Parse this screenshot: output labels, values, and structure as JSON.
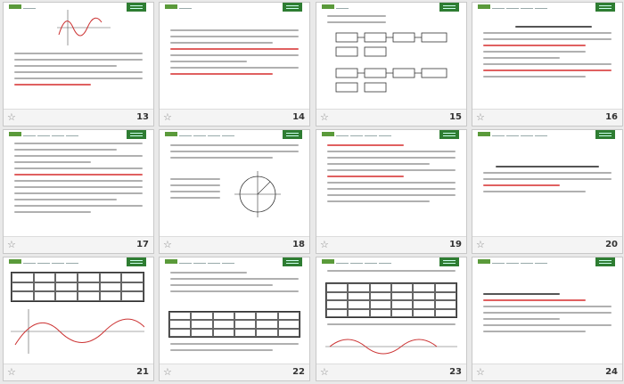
{
  "slides": [
    {
      "number": "13"
    },
    {
      "number": "14"
    },
    {
      "number": "15"
    },
    {
      "number": "16"
    },
    {
      "number": "17"
    },
    {
      "number": "18"
    },
    {
      "number": "19"
    },
    {
      "number": "20"
    },
    {
      "number": "21"
    },
    {
      "number": "22"
    },
    {
      "number": "23"
    },
    {
      "number": "24"
    }
  ],
  "star_glyph": "☆"
}
